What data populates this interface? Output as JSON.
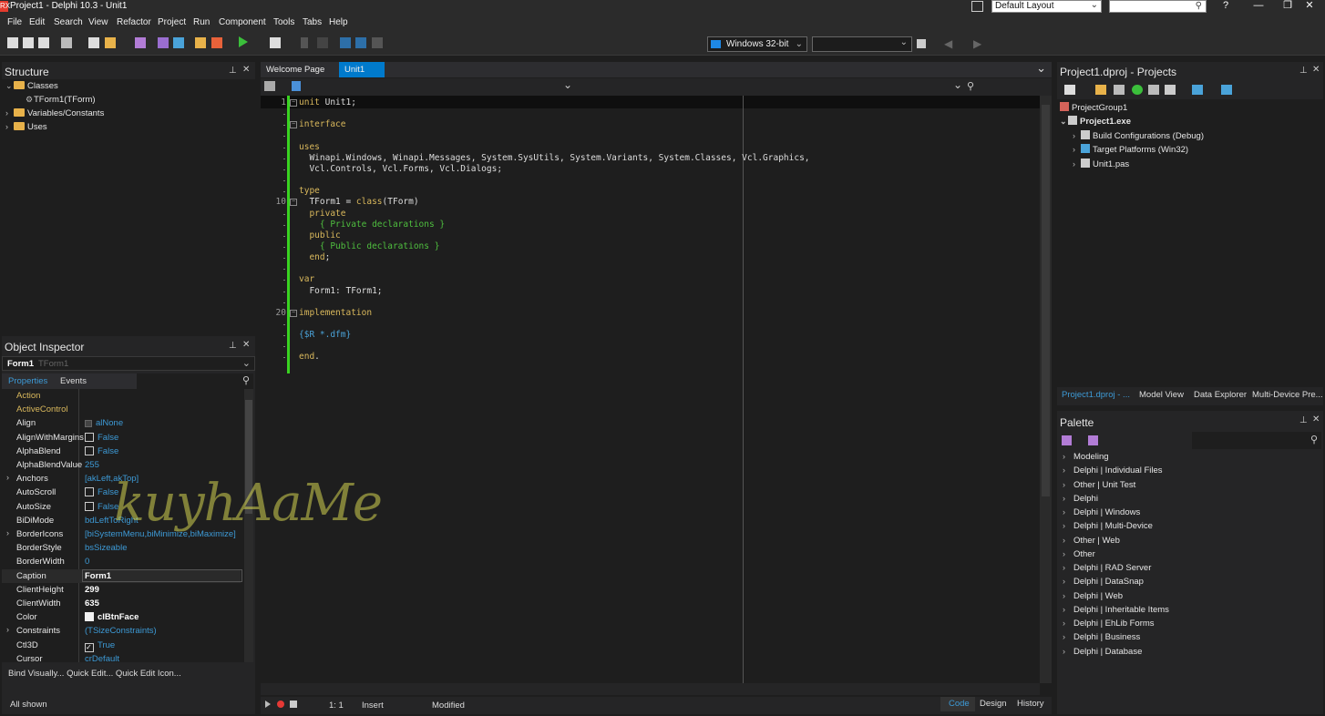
{
  "window": {
    "title": "Project1 - Delphi 10.3 - Unit1",
    "app_icon": "RX",
    "layout": "Default Layout",
    "controls": [
      "?",
      "—",
      "❐",
      "✕"
    ]
  },
  "menu": [
    "File",
    "Edit",
    "Search",
    "View",
    "Refactor",
    "Project",
    "Run",
    "Component",
    "Tools",
    "Tabs",
    "Help"
  ],
  "toolbar": {
    "platform": "Windows 32-bit"
  },
  "structure": {
    "title": "Structure",
    "items": [
      {
        "label": "Classes",
        "indent": 0,
        "expanded": true,
        "folder": true
      },
      {
        "label": "TForm1(TForm)",
        "indent": 1,
        "expanded": false,
        "folder": false
      },
      {
        "label": "Variables/Constants",
        "indent": 0,
        "expanded": false,
        "folder": true
      },
      {
        "label": "Uses",
        "indent": 0,
        "expanded": false,
        "folder": true
      }
    ]
  },
  "object_inspector": {
    "title": "Object Inspector",
    "component": "Form1",
    "component_type": "TForm1",
    "tabs": [
      "Properties",
      "Events"
    ],
    "rows": [
      {
        "name": "Action",
        "value": "",
        "style": "orange"
      },
      {
        "name": "ActiveControl",
        "value": "",
        "style": "orange"
      },
      {
        "name": "Align",
        "value": "alNone",
        "style": "normal",
        "icon": "dot"
      },
      {
        "name": "AlignWithMargins",
        "value": "False",
        "style": "normal",
        "icon": "checkbox"
      },
      {
        "name": "AlphaBlend",
        "value": "False",
        "style": "normal",
        "icon": "checkbox"
      },
      {
        "name": "AlphaBlendValue",
        "value": "255",
        "style": "normal"
      },
      {
        "name": "Anchors",
        "value": "[akLeft,akTop]",
        "style": "normal",
        "expand": true
      },
      {
        "name": "AutoScroll",
        "value": "False",
        "style": "normal",
        "icon": "checkbox"
      },
      {
        "name": "AutoSize",
        "value": "False",
        "style": "normal",
        "icon": "checkbox"
      },
      {
        "name": "BiDiMode",
        "value": "bdLeftToRight",
        "style": "normal"
      },
      {
        "name": "BorderIcons",
        "value": "[biSystemMenu,biMinimize,biMaximize]",
        "style": "normal",
        "expand": true
      },
      {
        "name": "BorderStyle",
        "value": "bsSizeable",
        "style": "normal"
      },
      {
        "name": "BorderWidth",
        "value": "0",
        "style": "normal"
      },
      {
        "name": "Caption",
        "value": "Form1",
        "style": "bold",
        "selected": true
      },
      {
        "name": "ClientHeight",
        "value": "299",
        "style": "bold"
      },
      {
        "name": "ClientWidth",
        "value": "635",
        "style": "bold"
      },
      {
        "name": "Color",
        "value": "clBtnFace",
        "style": "bold",
        "icon": "swatch"
      },
      {
        "name": "Constraints",
        "value": "(TSizeConstraints)",
        "style": "normal",
        "expand": true
      },
      {
        "name": "Ctl3D",
        "value": "True",
        "style": "normal",
        "icon": "checked"
      },
      {
        "name": "Cursor",
        "value": "crDefault",
        "style": "normal"
      }
    ],
    "footer_links": "Bind Visually... Quick Edit... Quick Edit Icon...",
    "status": "All shown"
  },
  "editor": {
    "tabs": [
      {
        "label": "Welcome Page",
        "active": false
      },
      {
        "label": "Unit1",
        "active": true
      }
    ],
    "code": [
      {
        "n": "1",
        "segs": [
          [
            "kw",
            "unit"
          ],
          [
            "txt",
            " Unit1;"
          ]
        ]
      },
      {
        "n": "",
        "segs": []
      },
      {
        "n": "",
        "segs": [
          [
            "kw",
            "interface"
          ]
        ]
      },
      {
        "n": "",
        "segs": []
      },
      {
        "n": "",
        "segs": [
          [
            "kw",
            "uses"
          ]
        ]
      },
      {
        "n": "",
        "segs": [
          [
            "txt",
            "  Winapi.Windows, Winapi.Messages, System.SysUtils, System.Variants, System.Classes, Vcl.Graphics,"
          ]
        ]
      },
      {
        "n": "",
        "segs": [
          [
            "txt",
            "  Vcl.Controls, Vcl.Forms, Vcl.Dialogs;"
          ]
        ]
      },
      {
        "n": "",
        "segs": []
      },
      {
        "n": "",
        "segs": [
          [
            "kw",
            "type"
          ]
        ]
      },
      {
        "n": "10",
        "segs": [
          [
            "txt",
            "  TForm1 = "
          ],
          [
            "kw",
            "class"
          ],
          [
            "txt",
            "(TForm)"
          ]
        ]
      },
      {
        "n": "",
        "segs": [
          [
            "txt",
            "  "
          ],
          [
            "kw",
            "private"
          ]
        ]
      },
      {
        "n": "",
        "segs": [
          [
            "cm",
            "    { Private declarations }"
          ]
        ]
      },
      {
        "n": "",
        "segs": [
          [
            "txt",
            "  "
          ],
          [
            "kw",
            "public"
          ]
        ]
      },
      {
        "n": "",
        "segs": [
          [
            "cm",
            "    { Public declarations }"
          ]
        ]
      },
      {
        "n": "",
        "segs": [
          [
            "txt",
            "  "
          ],
          [
            "kw",
            "end"
          ],
          [
            "txt",
            ";"
          ]
        ]
      },
      {
        "n": "",
        "segs": []
      },
      {
        "n": "",
        "segs": [
          [
            "kw",
            "var"
          ]
        ]
      },
      {
        "n": "",
        "segs": [
          [
            "txt",
            "  Form1: TForm1;"
          ]
        ]
      },
      {
        "n": "",
        "segs": []
      },
      {
        "n": "20",
        "segs": [
          [
            "kw",
            "implementation"
          ]
        ]
      },
      {
        "n": "",
        "segs": []
      },
      {
        "n": "",
        "segs": [
          [
            "dir",
            "{$R *.dfm}"
          ]
        ]
      },
      {
        "n": "",
        "segs": []
      },
      {
        "n": "",
        "segs": [
          [
            "kw",
            "end"
          ],
          [
            "txt",
            "."
          ]
        ]
      }
    ],
    "status": {
      "position": "1: 1",
      "mode": "Insert",
      "modified": "Modified"
    },
    "view_tabs": [
      {
        "label": "Code",
        "active": true
      },
      {
        "label": "Design",
        "active": false
      },
      {
        "label": "History",
        "active": false
      }
    ]
  },
  "projects": {
    "title": "Project1.dproj - Projects",
    "items": [
      {
        "label": "ProjectGroup1",
        "indent": 0,
        "bold": false,
        "expand": false
      },
      {
        "label": "Project1.exe",
        "indent": 0,
        "bold": true,
        "expand": true
      },
      {
        "label": "Build Configurations (Debug)",
        "indent": 1,
        "bold": false,
        "expand": true
      },
      {
        "label": "Target Platforms (Win32)",
        "indent": 1,
        "bold": false,
        "expand": true
      },
      {
        "label": "Unit1.pas",
        "indent": 1,
        "bold": false,
        "expand": true
      }
    ],
    "tabs": [
      "Project1.dproj - ...",
      "Model View",
      "Data Explorer",
      "Multi-Device Pre..."
    ]
  },
  "palette": {
    "title": "Palette",
    "items": [
      "Modeling",
      "Delphi | Individual Files",
      "Other | Unit Test",
      "Delphi",
      "Delphi | Windows",
      "Delphi | Multi-Device",
      "Other | Web",
      "Other",
      "Delphi | RAD Server",
      "Delphi | DataSnap",
      "Delphi | Web",
      "Delphi | Inheritable Items",
      "Delphi | EhLib Forms",
      "Delphi | Business",
      "Delphi | Database"
    ]
  },
  "watermark": "kuyhAaMe",
  "colors": {
    "keyword": "#d9b85c",
    "comment": "#4fbf3f",
    "directive": "#4aa3d9",
    "accent": "#3d9ad6",
    "change_bar": "#39d321"
  }
}
